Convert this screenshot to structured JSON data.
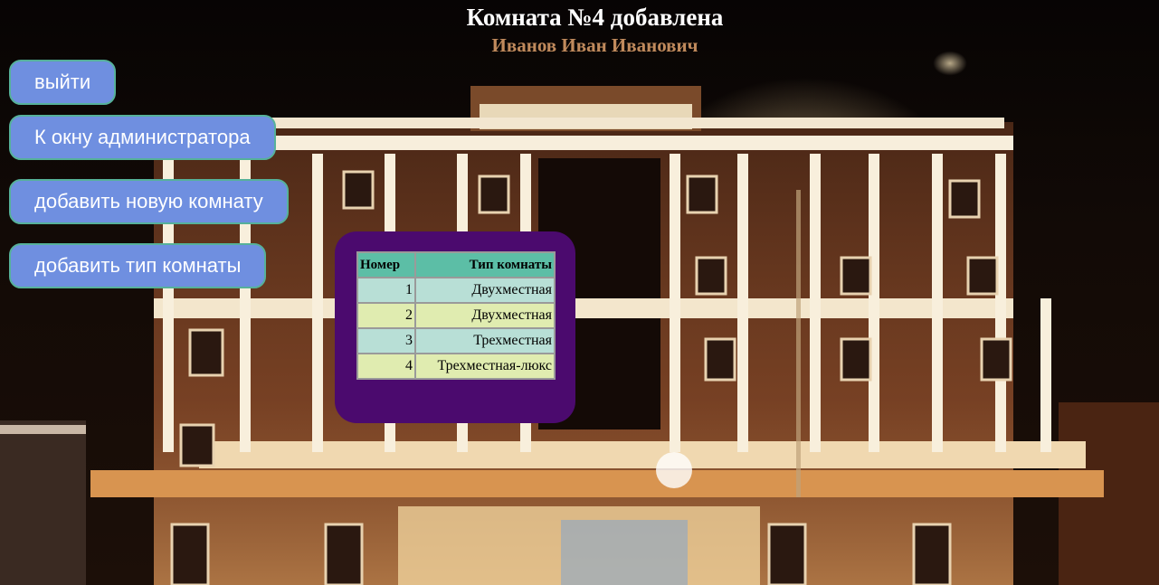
{
  "header": {
    "title": "Комната №4 добавлена",
    "user_name": "Иванов Иван Иванович"
  },
  "nav": {
    "logout": "выйти",
    "admin_window": "К окну администратора",
    "add_room": "добавить новую комнату",
    "add_room_type": "добавить тип комнаты"
  },
  "rooms_table": {
    "columns": [
      "Номер",
      "Тип комнаты"
    ],
    "rows": [
      {
        "number": "1",
        "type": "Двухместная"
      },
      {
        "number": "2",
        "type": "Двухместная"
      },
      {
        "number": "3",
        "type": "Трехместная"
      },
      {
        "number": "4",
        "type": "Трехместная-люкс"
      }
    ]
  },
  "colors": {
    "button_fill": "#6f8fe0",
    "button_border": "#56b19a",
    "panel": "#4b0a6e",
    "table_header": "#5cbea6",
    "row_odd": "#b8dfd6",
    "row_even": "#e0ecb0",
    "user_name": "#c08a5c"
  }
}
